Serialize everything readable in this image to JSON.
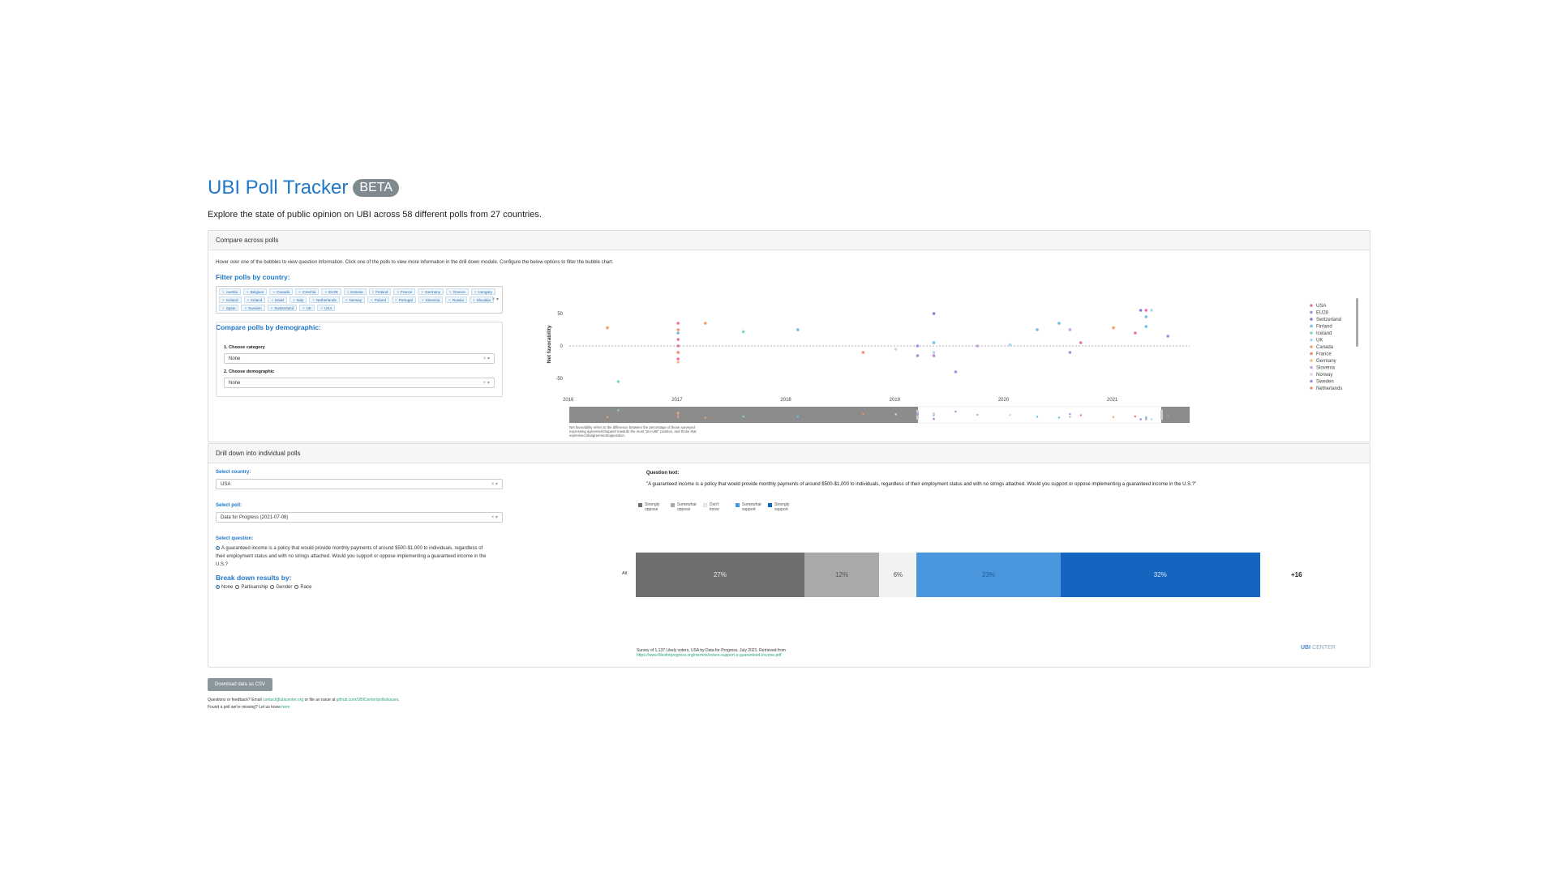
{
  "app": {
    "title": "UBI Poll Tracker",
    "badge": "BETA",
    "subtitle": "Explore the state of public opinion on UBI across 58 different polls from 27 countries."
  },
  "compare": {
    "header": "Compare across polls",
    "hint": "Hover over one of the bubbles to view question information. Click one of the polls to view more information in the drill down module. Configure the below options to filter the bubble chart.",
    "filter_label": "Filter polls by country:",
    "countries": [
      "Austria",
      "Belgium",
      "Canada",
      "Czechia",
      "EU28",
      "Estonia",
      "Finland",
      "France",
      "Germany",
      "Greece",
      "Hungary",
      "Iceland",
      "Ireland",
      "Israel",
      "Italy",
      "Netherlands",
      "Norway",
      "Poland",
      "Portugal",
      "Slovenia",
      "Russia",
      "Slovakia",
      "Spain",
      "Sweden",
      "Switzerland",
      "UK",
      "USA"
    ],
    "demo_label": "Compare polls by demographic:",
    "category_label": "1. Choose category",
    "category_value": "None",
    "demographic_label": "2. Choose demographic",
    "demographic_value": "None",
    "clear_symbol": "×",
    "caret_symbol": "▾"
  },
  "chart_data": {
    "type": "scatter",
    "ylabel": "Net favorability",
    "xlabel": "",
    "yticks": [
      50,
      0,
      -50
    ],
    "ylim": [
      -60,
      65
    ],
    "xlim": [
      2016.0,
      2021.7
    ],
    "xticks": [
      "2016",
      "2017",
      "2018",
      "2019",
      "2020",
      "2021"
    ],
    "grid": false,
    "legend": "right",
    "note": "Net favorability refers to the difference between the percentage of those surveyed expressing agreement/support towards the most \"pro-UBI\" position, and those that expressed disagreement/opposition.",
    "series": [
      {
        "name": "USA",
        "color": "#e8749a",
        "points": [
          [
            2017.0,
            35
          ],
          [
            2017.0,
            10
          ],
          [
            2017.0,
            0
          ],
          [
            2017.0,
            -20
          ],
          [
            2020.7,
            5
          ],
          [
            2021.2,
            20
          ],
          [
            2021.3,
            55
          ]
        ]
      },
      {
        "name": "EU28",
        "color": "#b08ad8",
        "points": [
          [
            2019.2,
            -15
          ],
          [
            2019.35,
            -15
          ],
          [
            2019.55,
            -40
          ],
          [
            2020.6,
            -10
          ],
          [
            2021.5,
            15
          ]
        ]
      },
      {
        "name": "Switzerland",
        "color": "#8a7ad8",
        "points": [
          [
            2019.35,
            50
          ],
          [
            2021.25,
            55
          ]
        ]
      },
      {
        "name": "Finland",
        "color": "#6ac0e8",
        "points": [
          [
            2017.0,
            20
          ],
          [
            2018.1,
            25
          ],
          [
            2019.35,
            5
          ],
          [
            2020.3,
            25
          ],
          [
            2020.5,
            35
          ],
          [
            2021.3,
            45
          ],
          [
            2021.3,
            30
          ]
        ]
      },
      {
        "name": "Iceland",
        "color": "#7ad8d0",
        "points": [
          [
            2016.45,
            -55
          ],
          [
            2017.6,
            22
          ]
        ]
      },
      {
        "name": "UK",
        "color": "#a8d8f0",
        "points": [
          [
            2019.35,
            -10
          ],
          [
            2020.05,
            2
          ],
          [
            2021.35,
            55
          ]
        ]
      },
      {
        "name": "Canada",
        "color": "#f0a068",
        "points": [
          [
            2016.35,
            28
          ],
          [
            2017.0,
            25
          ],
          [
            2017.25,
            35
          ],
          [
            2021.0,
            28
          ]
        ]
      },
      {
        "name": "France",
        "color": "#f08a6a",
        "points": [
          [
            2017.0,
            -10
          ]
        ]
      },
      {
        "name": "Germany",
        "color": "#f0c080",
        "points": [
          [
            2017.0,
            -25
          ]
        ]
      },
      {
        "name": "Slovenia",
        "color": "#c8a0e0",
        "points": [
          [
            2019.75,
            0
          ],
          [
            2020.6,
            25
          ]
        ]
      },
      {
        "name": "Norway",
        "color": "#e8c8f0",
        "points": [
          [
            2019.0,
            -5
          ]
        ]
      },
      {
        "name": "Sweden",
        "color": "#9a90e8",
        "points": [
          [
            2019.2,
            0
          ]
        ]
      },
      {
        "name": "Netherlands",
        "color": "#e89070",
        "points": [
          [
            2018.7,
            -10
          ]
        ]
      }
    ]
  },
  "drill": {
    "header": "Drill down into individual polls",
    "country_label": "Select country:",
    "country_value": "USA",
    "poll_label": "Select poll:",
    "poll_value": "Data for Progress (2021-07-08)",
    "question_label": "Select question:",
    "question_option": "A guaranteed income is a policy that would provide monthly payments of around $500-$1,000 to individuals, regardless of their employment status and with no strings attached. Would you support or oppose implementing a guaranteed income in the U.S.?",
    "breakdown_label": "Break down results by:",
    "breakdown_options": [
      "None",
      "Partisanship",
      "Gender",
      "Race"
    ],
    "breakdown_selected": "None",
    "question_text_label": "Question text:",
    "question_text": "\"A guaranteed income is a policy that would provide monthly payments of around $500-$1,000 to individuals, regardless of their employment status and with no strings attached. Would you support or oppose implementing a guaranteed income in the U.S.?\"",
    "legend": [
      {
        "label": "Strongly oppose",
        "color": "#6f6f6f"
      },
      {
        "label": "Somewhat oppose",
        "color": "#a9a9a9"
      },
      {
        "label": "Don't know",
        "color": "#f0f0f0"
      },
      {
        "label": "Somewhat support",
        "color": "#4a97de"
      },
      {
        "label": "Strongly support",
        "color": "#1565c0"
      }
    ],
    "row_label": "All",
    "segments": [
      {
        "label": "27%",
        "value": 27,
        "color": "#6f6f6f",
        "text_color": "#eaeaea"
      },
      {
        "label": "12%",
        "value": 12,
        "color": "#a9a9a9",
        "text_color": "#555555"
      },
      {
        "label": "6%",
        "value": 6,
        "color": "#f2f2f2",
        "text_color": "#555555"
      },
      {
        "label": "23%",
        "value": 23,
        "color": "#4a97de",
        "text_color": "#1f5a92"
      },
      {
        "label": "32%",
        "value": 32,
        "color": "#1565c0",
        "text_color": "#dfe9f7"
      }
    ],
    "net_label": "+16",
    "source_text": "Survey of 1,137 Likely voters, USA by Data for Progress, July 2021. Retrieved from",
    "source_link": "https://www.filesforprogress.org/memos/voters-support-a-guaranteed-income.pdf",
    "logo_bold": "UBI",
    "logo_rest": " CENTER"
  },
  "footer": {
    "download": "Download data as CSV",
    "line1_a": "Questions or feedback? Email ",
    "email": "contact@ubicenter.org",
    "line1_b": " or file an issue at ",
    "issue_link": "github.com/UBICenter/polls/issues",
    "line1_c": ".",
    "line2_a": "Found a poll we're missing? Let us know ",
    "here": "here"
  }
}
